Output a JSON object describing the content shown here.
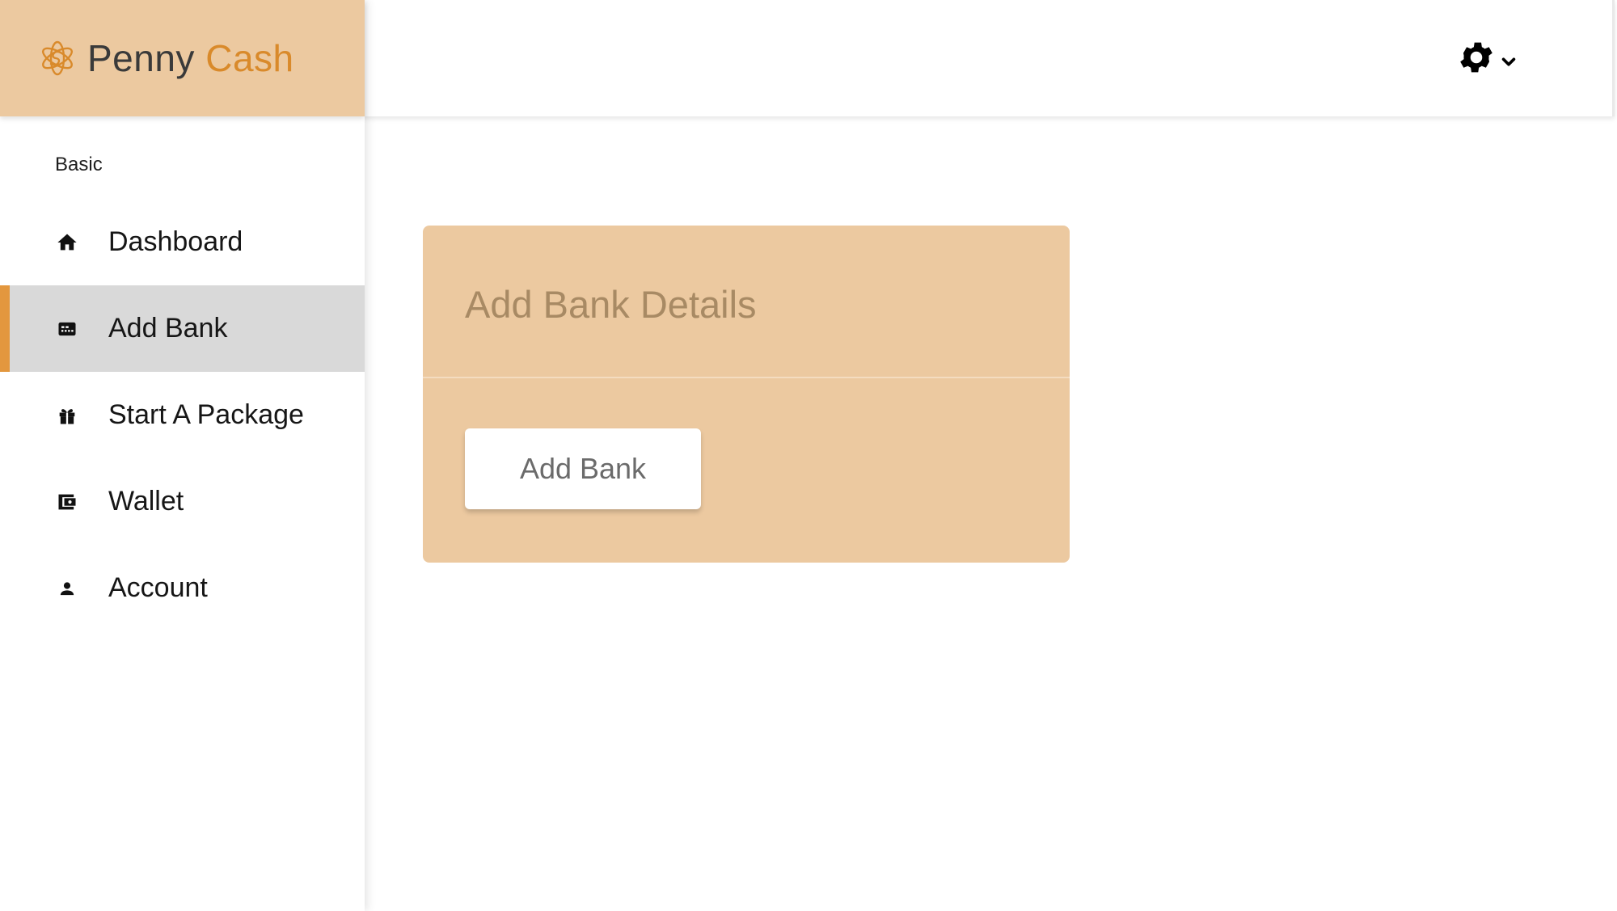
{
  "brand": {
    "name_part1": "Penny",
    "name_part2": "Cash",
    "logo_icon": "atom-coin-icon"
  },
  "sidebar": {
    "section_label": "Basic",
    "items": [
      {
        "label": "Dashboard",
        "icon": "home-icon",
        "active": false
      },
      {
        "label": "Add Bank",
        "icon": "bank-card-icon",
        "active": true
      },
      {
        "label": "Start A Package",
        "icon": "gift-icon",
        "active": false
      },
      {
        "label": "Wallet",
        "icon": "wallet-icon",
        "active": false
      },
      {
        "label": "Account",
        "icon": "user-icon",
        "active": false
      }
    ]
  },
  "topbar": {
    "settings_icon": "gear-icon",
    "dropdown_icon": "chevron-down-icon"
  },
  "main": {
    "card": {
      "title": "Add Bank Details",
      "button_label": "Add Bank"
    }
  },
  "colors": {
    "brand_bg": "#ecc9a0",
    "accent": "#d98a2b",
    "active_indicator": "#e3973e",
    "active_bg": "#d9d9d9",
    "card_title": "#a88a64"
  }
}
